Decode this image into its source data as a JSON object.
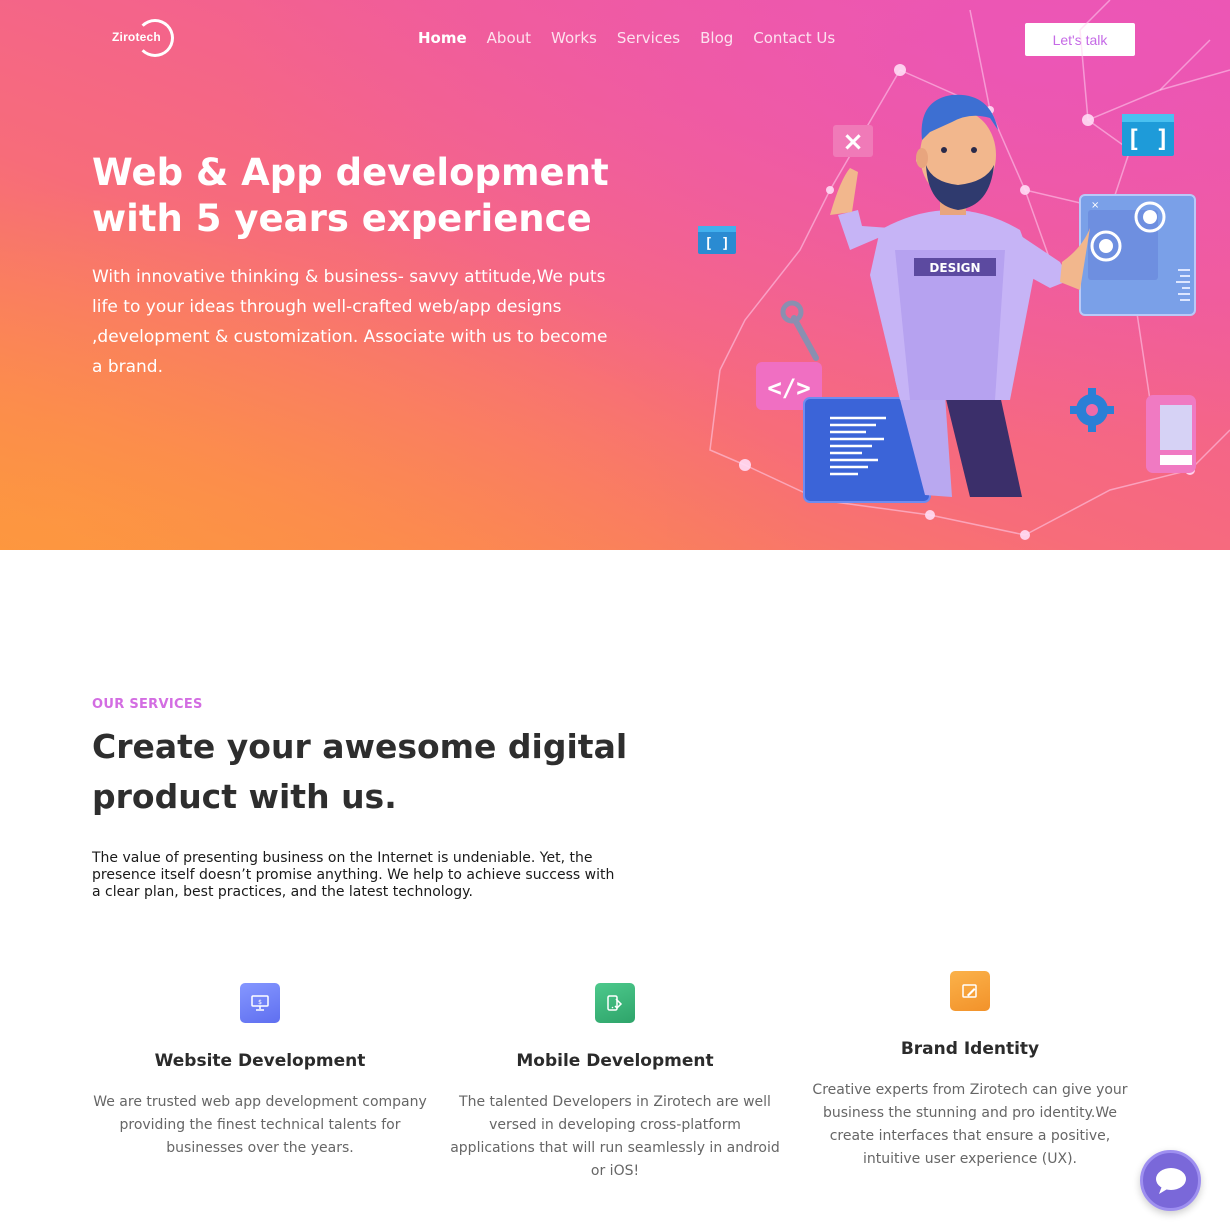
{
  "header": {
    "logo_text": "Zirotech",
    "nav": [
      {
        "label": "Home"
      },
      {
        "label": "About"
      },
      {
        "label": "Works"
      },
      {
        "label": "Services"
      },
      {
        "label": "Blog"
      },
      {
        "label": "Contact Us"
      }
    ],
    "cta_label": "Let's talk"
  },
  "hero": {
    "title": "Web & App development with 5 years experience",
    "text": "With innovative thinking & business- savvy attitude,We puts life to your ideas through well-crafted web/app designs ,development & customization. Associate with us to become a brand.",
    "illustration": {
      "shirt_text": "DESIGN",
      "code_tag": "</>",
      "brackets": "[ ]",
      "close_glyph": "×"
    }
  },
  "services": {
    "eyebrow": "OUR SERVICES",
    "title": "Create your awesome digital product with us.",
    "text": "The value of presenting business on the Internet is undeniable. Yet, the presence itself doesn’t promise anything. We help to achieve success with a clear plan, best practices, and the latest technology.",
    "cards": [
      {
        "title": "Website Development",
        "text": "We are trusted web app development company providing the finest technical talents for businesses over the years.",
        "icon": "monitor-icon",
        "color": "#6f7ff5"
      },
      {
        "title": "Mobile Development",
        "text": "The talented Developers in Zirotech are well versed in developing cross-platform applications that will run seamlessly in android or iOS!",
        "icon": "mobile-design-icon",
        "color": "#3db67a"
      },
      {
        "title": "Brand Identity",
        "text": "Creative experts from Zirotech can give your business the stunning and pro identity.We create interfaces that ensure a positive, intuitive user experience (UX).",
        "icon": "brand-pen-icon",
        "color": "#f6a23a"
      }
    ]
  },
  "chat": {
    "icon": "chat-bubble-icon"
  }
}
